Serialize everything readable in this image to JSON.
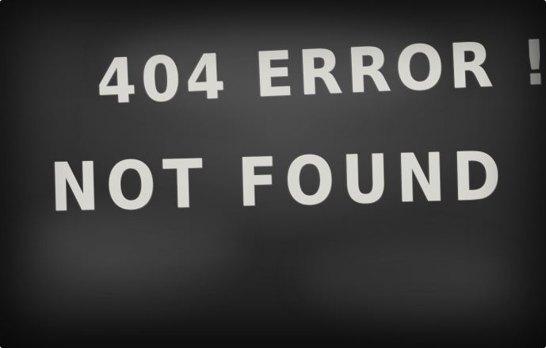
{
  "chalkboard": {
    "line_1": "404 ERROR !",
    "line_2": "NOT FOUND"
  },
  "colors": {
    "chalk": "#e4e2dc",
    "board": "#2b2b2b"
  }
}
